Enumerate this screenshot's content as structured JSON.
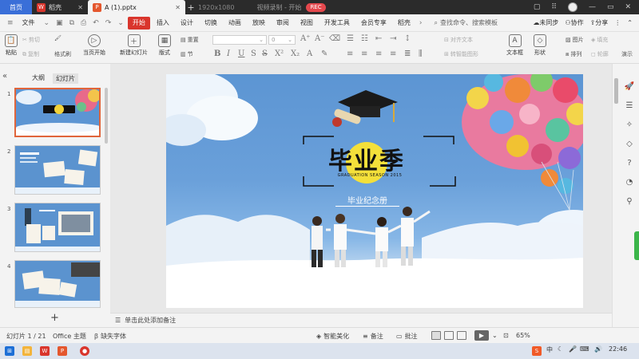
{
  "tabs": {
    "home": "首页",
    "daoke": "稻壳",
    "file": "A (1).pptx",
    "resolution": "1920x1080",
    "recording_title": "视频录制 - 开始",
    "rec": "REC"
  },
  "menubar": {
    "file": "文件",
    "items": [
      "开始",
      "插入",
      "设计",
      "切换",
      "动画",
      "放映",
      "审阅",
      "视图",
      "开发工具",
      "会员专享",
      "稻壳"
    ],
    "search": "查找命令、搜索模板",
    "sync": "未同步",
    "collab": "协作",
    "share": "分享"
  },
  "ribbon": {
    "cut": "剪切",
    "copy": "复制",
    "format_painter": "格式刷",
    "paste": "粘贴",
    "from_current": "当页开始",
    "new_slide": "新建幻灯片",
    "layout": "版式",
    "section": "节",
    "reset": "重置",
    "font_size": "0",
    "align_text": "对齐文本",
    "convert_smartart": "转智能图形",
    "textbox": "文本框",
    "shape": "形状",
    "arrange": "排列",
    "picture": "图片",
    "fill": "填充",
    "outline": "轮廓",
    "present_tool": "演示"
  },
  "leftpanel": {
    "outline_tab": "大纲",
    "slides_tab": "幻灯片",
    "thumb_numbers": [
      "1",
      "2",
      "3",
      "4"
    ]
  },
  "slide": {
    "title": "毕业季",
    "subtitle": "GRADUATION SEASON 2015",
    "album": "毕业纪念册"
  },
  "notes": {
    "placeholder": "单击此处添加备注"
  },
  "statusbar": {
    "slide_pos": "幻灯片 1 / 21",
    "theme": "Office 主题",
    "font_missing": "缺失字体",
    "beautify": "智能美化",
    "notes": "备注",
    "comments": "批注",
    "zoom": "65%"
  },
  "taskbar": {
    "ime": "中",
    "time": "22:46"
  },
  "colors": {
    "accent": "#d9352c",
    "home_tab": "#3a6fd8",
    "slide_sky": "#5c95d3"
  }
}
